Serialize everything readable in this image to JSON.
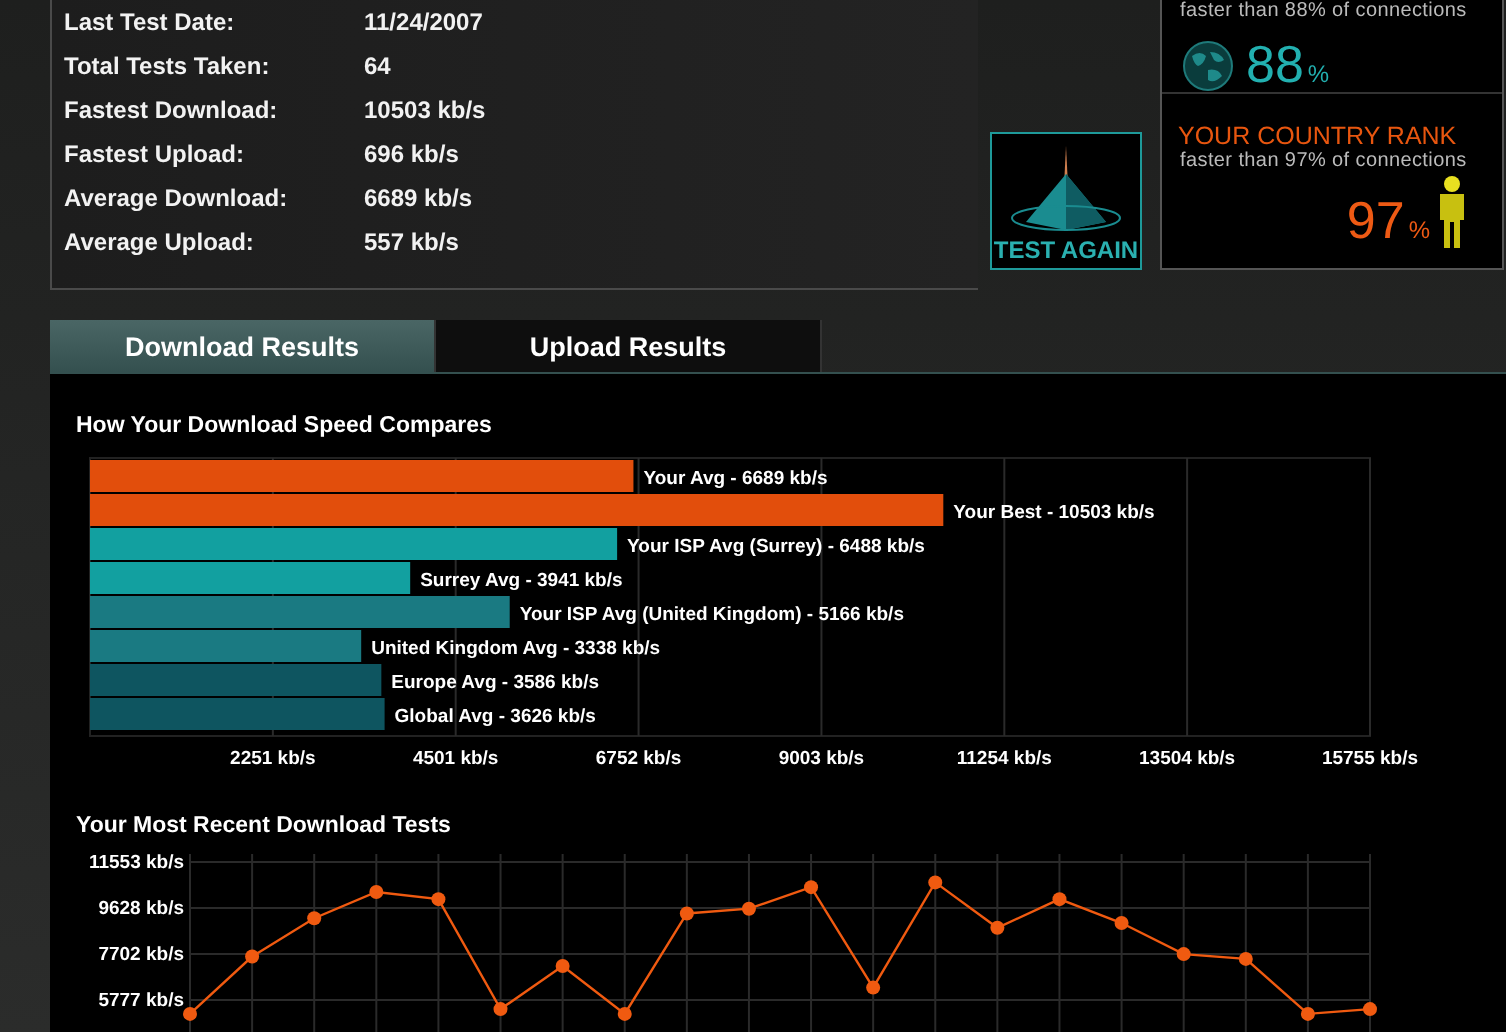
{
  "stats": [
    {
      "label": "Last Test Date:",
      "value": "11/24/2007"
    },
    {
      "label": "Total Tests Taken:",
      "value": "64"
    },
    {
      "label": "Fastest Download:",
      "value": "10503 kb/s"
    },
    {
      "label": "Fastest Upload:",
      "value": "696 kb/s"
    },
    {
      "label": "Average Download:",
      "value": "6689 kb/s"
    },
    {
      "label": "Average Upload:",
      "value": "557 kb/s"
    }
  ],
  "test_again": {
    "label": "TEST AGAIN"
  },
  "rank": {
    "world": {
      "caption": "faster than 88% of connections",
      "value": "88",
      "unit": "%"
    },
    "country": {
      "title": "YOUR COUNTRY RANK",
      "caption": "faster than 97% of connections",
      "value": "97",
      "unit": "%"
    }
  },
  "tabs": [
    {
      "label": "Download Results",
      "selected": true
    },
    {
      "label": "Upload Results",
      "selected": false
    }
  ],
  "bar_chart": {
    "chart_data": {
      "type": "bar",
      "orientation": "horizontal",
      "title": "How Your Download Speed Compares",
      "grid": true,
      "categories": [
        "Your Avg - 6689 kb/s",
        "Your Best - 10503 kb/s",
        "Your ISP Avg (Surrey) - 6488 kb/s",
        "Surrey Avg - 3941 kb/s",
        "Your ISP Avg (United Kingdom) - 5166 kb/s",
        "United Kingdom Avg - 3338 kb/s",
        "Europe Avg - 3586 kb/s",
        "Global Avg - 3626 kb/s"
      ],
      "series": [
        {
          "color": "#e24e0c",
          "values": [
            6689,
            10503,
            null,
            null,
            null,
            null,
            null,
            null
          ]
        },
        {
          "color": "#12a0a0",
          "values": [
            null,
            null,
            6488,
            3941,
            null,
            null,
            null,
            null
          ]
        },
        {
          "color": "#1a7a82",
          "values": [
            null,
            null,
            null,
            null,
            5166,
            3338,
            null,
            null
          ]
        },
        {
          "color": "#0e5560",
          "values": [
            null,
            null,
            null,
            null,
            null,
            null,
            3586,
            3626
          ]
        }
      ],
      "xlim": [
        0,
        15755
      ],
      "xticks": [
        {
          "value": 2251,
          "label": "2251 kb/s"
        },
        {
          "value": 4501,
          "label": "4501 kb/s"
        },
        {
          "value": 6752,
          "label": "6752 kb/s"
        },
        {
          "value": 9003,
          "label": "9003 kb/s"
        },
        {
          "value": 11254,
          "label": "11254 kb/s"
        },
        {
          "value": 13504,
          "label": "13504 kb/s"
        },
        {
          "value": 15755,
          "label": "15755 kb/s"
        }
      ]
    }
  },
  "line_chart": {
    "chart_data": {
      "type": "line",
      "title": "Your Most Recent Download Tests",
      "grid": true,
      "series": [
        {
          "color": "#f05a10",
          "marker": "o",
          "values": [
            5200,
            7600,
            9200,
            10300,
            10000,
            5400,
            7200,
            5200,
            9400,
            9600,
            10500,
            6300,
            10700,
            8800,
            10000,
            9000,
            7700,
            7500,
            5200,
            5400
          ]
        }
      ],
      "ylim": [
        4400,
        11553
      ],
      "yticks": [
        {
          "value": 5777,
          "label": "5777 kb/s"
        },
        {
          "value": 7702,
          "label": "7702 kb/s"
        },
        {
          "value": 9628,
          "label": "9628 kb/s"
        },
        {
          "value": 11553,
          "label": "11553 kb/s"
        }
      ]
    }
  }
}
